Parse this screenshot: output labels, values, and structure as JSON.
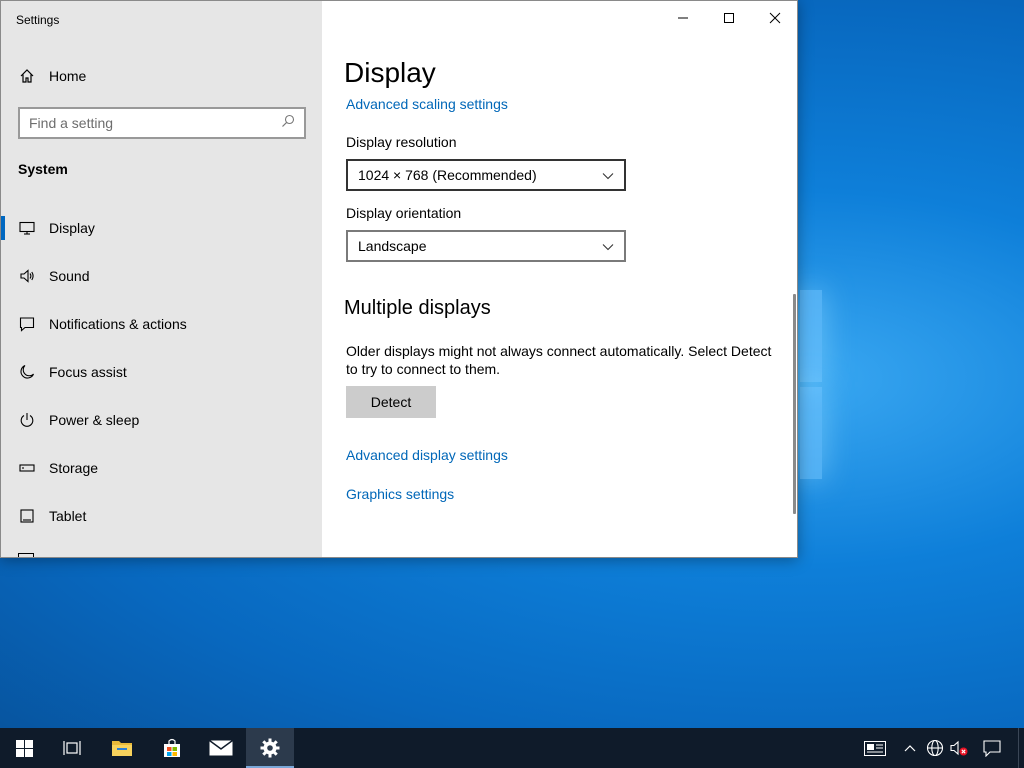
{
  "window": {
    "title": "Settings",
    "controls": {
      "minimize": "minimize",
      "maximize": "maximize",
      "close": "close"
    }
  },
  "sidebar": {
    "home_label": "Home",
    "search_placeholder": "Find a setting",
    "section": "System",
    "items": [
      {
        "label": "Display",
        "icon": "monitor-icon",
        "active": true
      },
      {
        "label": "Sound",
        "icon": "speaker-icon"
      },
      {
        "label": "Notifications & actions",
        "icon": "notification-icon"
      },
      {
        "label": "Focus assist",
        "icon": "moon-icon"
      },
      {
        "label": "Power & sleep",
        "icon": "power-icon"
      },
      {
        "label": "Storage",
        "icon": "storage-icon"
      },
      {
        "label": "Tablet",
        "icon": "tablet-icon"
      }
    ]
  },
  "main": {
    "title": "Display",
    "advanced_scaling_link": "Advanced scaling settings",
    "resolution": {
      "label": "Display resolution",
      "value": "1024 × 768 (Recommended)"
    },
    "orientation": {
      "label": "Display orientation",
      "value": "Landscape"
    },
    "multiple_displays": {
      "heading": "Multiple displays",
      "description": "Older displays might not always connect automatically. Select Detect to try to connect to them.",
      "detect_button": "Detect"
    },
    "advanced_display_link": "Advanced display settings",
    "graphics_link": "Graphics settings"
  },
  "colors": {
    "accent": "#0067c0",
    "link": "#0067b8",
    "sidebar_bg": "#e6e6e6",
    "taskbar_bg": "#0f1b2a",
    "desktop_bg": "#0e7fd9"
  },
  "taskbar": {
    "items": [
      "start-icon",
      "task-view-icon",
      "file-explorer-icon",
      "store-icon",
      "mail-icon",
      "settings-icon"
    ],
    "tray": [
      "news-icon",
      "chevron-up-icon",
      "network-icon",
      "volume-muted-icon",
      "action-center-icon"
    ]
  }
}
